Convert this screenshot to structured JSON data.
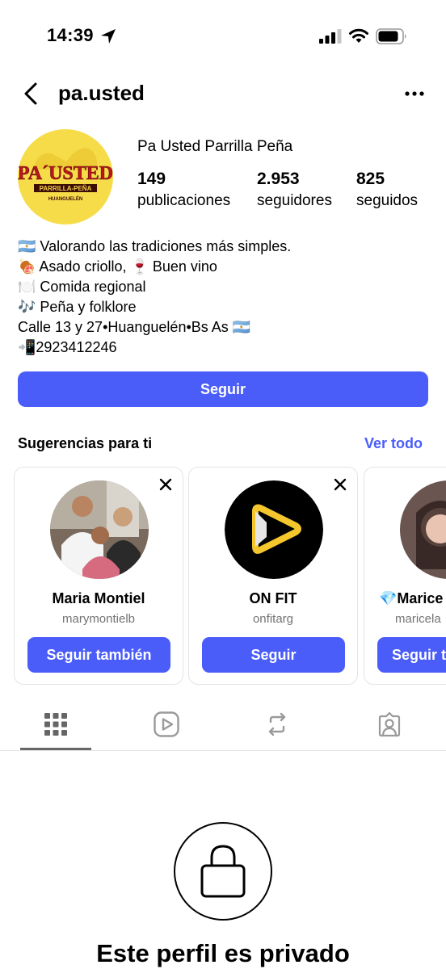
{
  "status_bar": {
    "time": "14:39"
  },
  "header": {
    "username": "pa.usted"
  },
  "profile": {
    "display_name": "Pa Usted Parrilla Peña",
    "logo_text": "PA´USTED",
    "logo_sub": "PARRILLA-PEÑA",
    "logo_place": "HUANGUELÉN",
    "stats": [
      {
        "value": "149",
        "label": "publicaciones"
      },
      {
        "value": "2.953",
        "label": "seguidores"
      },
      {
        "value": "825",
        "label": "seguidos"
      }
    ],
    "bio": [
      "🇦🇷  Valorando las tradiciones más simples.",
      "🍖 Asado criollo,  🍷 Buen vino",
      "🍽️  Comida regional",
      "🎶  Peña y folklore",
      "Calle 13 y 27•Huanguelén•Bs As 🇦🇷",
      "📲2923412246"
    ],
    "follow_label": "Seguir"
  },
  "suggestions": {
    "title": "Sugerencias para ti",
    "see_all": "Ver todo",
    "cards": [
      {
        "name": "Maria Montiel",
        "handle": "marymontielb",
        "button": "Seguir también"
      },
      {
        "name": "ON FIT",
        "handle": "onfitarg",
        "button": "Seguir"
      },
      {
        "name": "💎Marice",
        "handle": "maricela",
        "button": "Seguir t"
      }
    ]
  },
  "private": {
    "title": "Este perfil es privado"
  },
  "colors": {
    "accent": "#4a5df9",
    "logo_bg": "#f7dc4a",
    "logo_red": "#c0161d"
  },
  "icons": [
    "location-arrow-icon",
    "signal-icon",
    "wifi-icon",
    "battery-icon",
    "back-chevron-icon",
    "more-icon",
    "close-icon",
    "grid-icon",
    "reels-icon",
    "reposts-icon",
    "tagged-icon",
    "lock-icon"
  ]
}
